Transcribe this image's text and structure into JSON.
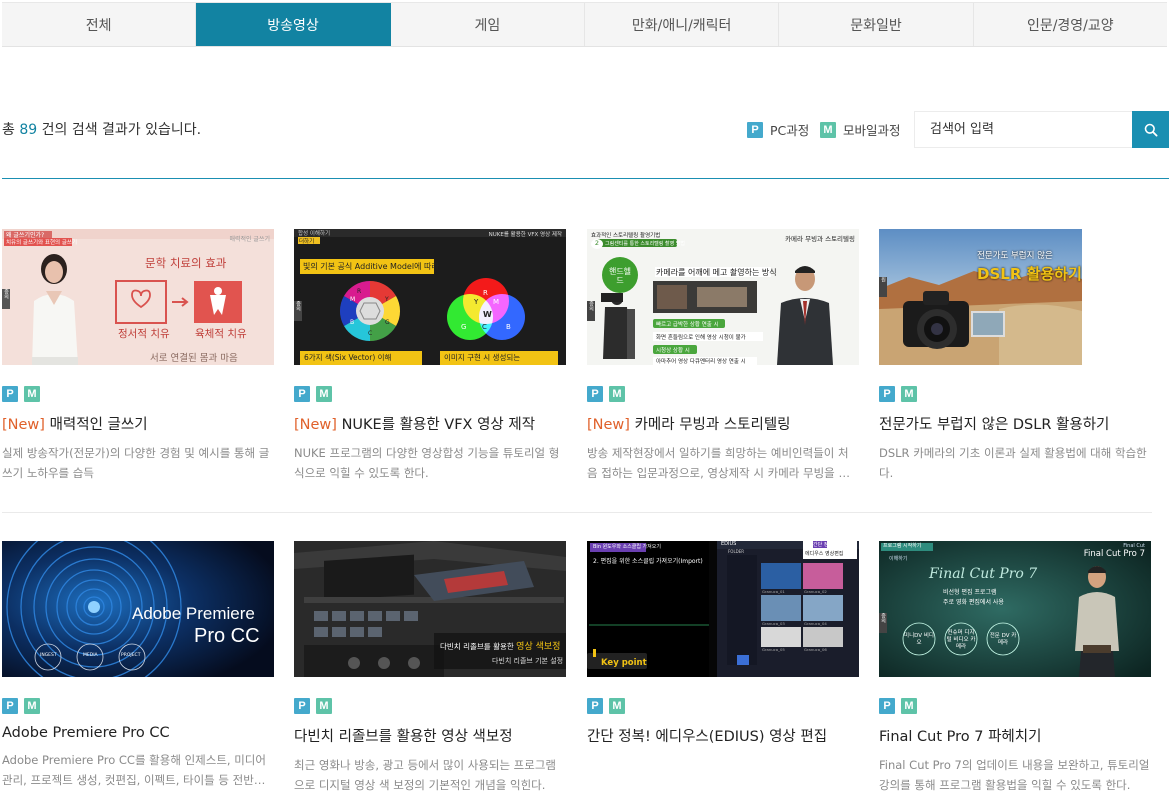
{
  "tabs": [
    {
      "label": "전체",
      "active": false
    },
    {
      "label": "방송영상",
      "active": true
    },
    {
      "label": "게임",
      "active": false
    },
    {
      "label": "만화/애니/캐릭터",
      "active": false
    },
    {
      "label": "문화일반",
      "active": false
    },
    {
      "label": "인문/경영/교양",
      "active": false
    }
  ],
  "results": {
    "prefix": "총",
    "count": "89",
    "suffix": "건의 검색 결과가 있습니다."
  },
  "legend": {
    "pc": {
      "badge": "P",
      "label": "PC과정"
    },
    "mobile": {
      "badge": "M",
      "label": "모바일과정"
    }
  },
  "search": {
    "placeholder": "검색어 입력",
    "button_icon": "search-icon"
  },
  "colors": {
    "accent": "#1283a2",
    "badge_pc": "#44a9cc",
    "badge_mobile": "#5ec3a8",
    "new_tag": "#e0612b"
  },
  "courses": [
    {
      "new_tag": "[New]",
      "title": "매력적인 글쓰기",
      "desc": "실제 방송작가(전문가)의 다양한 경험 및 예시를 통해 글쓰기 노하우를 습득",
      "badges": [
        "P",
        "M"
      ],
      "thumb": {
        "top_left": "왜 글쓰기인가?",
        "top_left_sub": "치유의 글쓰기와 표현의 글쓰기",
        "top_right": "매력적인 글쓰기",
        "heading": "문학 치료의 효과",
        "box_left": "정서적 치유",
        "box_right": "육체적 치유",
        "caption": "서로 연결된 몸과 마음",
        "side": "중의"
      }
    },
    {
      "new_tag": "[New]",
      "title": "NUKE를 활용한 VFX 영상 제작",
      "desc": "NUKE 프로그램의 다양한 영상합성 기능을 튜토리얼 형식으로 익힐 수 있도록 한다.",
      "badges": [
        "P",
        "M"
      ],
      "thumb": {
        "top_left": "합성 이해하기",
        "top_left_sub": "더하기",
        "brand": "NUKE를 활용한 VFX 영상 제작",
        "banner": "빛의 기본 공식 Additive Model에 따라",
        "caption_left": "6가지 색(Six Vector) 이해",
        "caption_right": "이미지 구현 시 생성되는",
        "side": "중의",
        "wheel": [
          "R",
          "Y",
          "G",
          "C",
          "B",
          "M"
        ],
        "rgb": [
          "R",
          "G",
          "B",
          "Y",
          "C",
          "M",
          "W"
        ]
      }
    },
    {
      "new_tag": "[New]",
      "title": "카메라 무빙과 스토리텔링",
      "desc": "방송 제작현장에서 일하기를 희망하는 예비인력들이 처음 접하는 입문과정으로, 영상제작 시 카메라 무빙을 통한 스토리텔링 기법을 익힌다.",
      "badges": [
        "P",
        "M"
      ],
      "thumb": {
        "top_left": "효과적인 스토리텔링 촬영기법",
        "step_num": "2",
        "step": "그림센티를 통한 스토리텔링 촬영 방법",
        "brand": "카메라 무빙과 스토리텔링",
        "circle": "핸드헬드",
        "headline": "카메라를 어깨에 메고 촬영하는 방식",
        "bullets": [
          "빠르고 급박한 상황 연출 시",
          "화면 흔들림으로 인해 영상 시청이 불가",
          "시청상 상황 시",
          "아마추어 영상 다큐멘터리 영상 연출 시"
        ],
        "side": "중의"
      }
    },
    {
      "new_tag": "",
      "title": "전문가도 부럽지 않은 DSLR 활용하기",
      "desc": "DSLR 카메라의 기초 이론과 실제 활용법에 대해 학습한다.",
      "badges": [
        "P",
        "M"
      ],
      "thumb": {
        "line1": "전문가도 부럽지 않은",
        "line2": "DSLR 활용하기",
        "side": "원"
      }
    },
    {
      "new_tag": "",
      "title": "Adobe Premiere Pro CC",
      "desc": "Adobe Premiere Pro CC를 활용해 인제스트, 미디어관리, 프로젝트 생성, 컷편집, 이펙트, 타이틀 등 전반적인 영상 편집 기능을 익힌다.",
      "badges": [
        "P",
        "M"
      ],
      "thumb": {
        "line1": "Adobe Premiere",
        "line2": "Pro CC",
        "chips": [
          "INGEST",
          "MEDIA",
          "PROJECT"
        ]
      }
    },
    {
      "new_tag": "",
      "title": "다빈치 리졸브를 활용한 영상 색보정",
      "desc": "최근 영화나 방송, 광고 등에서 많이 사용되는 프로그램으로 디지털 영상 색 보정의 기본적인 개념을 익힌다.",
      "badges": [
        "P",
        "M"
      ],
      "thumb": {
        "line1": "다빈치 리졸브를 활용한",
        "line1_hl": "영상 색보정",
        "line2": "다빈치 리졸브 기본 설정"
      }
    },
    {
      "new_tag": "",
      "title": "간단 정복! 에디우스(EDIUS) 영상 편집",
      "desc": "",
      "badges": [
        "P",
        "M"
      ],
      "thumb": {
        "top_left": "Bin 윈도우와 소스클립 가져오기",
        "step": "2. 편집을 위한 소스클립 가져오기(Import)",
        "brand": "에디우스 영상편집",
        "brand_tag": "간단 정복",
        "keypoint": "Key point",
        "app": "EDIUS",
        "folder": "FOLDER",
        "files": [
          "Granuca_01",
          "Granuca_02",
          "Granuca_03",
          "Granuca_04",
          "Granuca_05",
          "Granuca_06"
        ]
      }
    },
    {
      "new_tag": "",
      "title": "Final Cut Pro 7 파헤치기",
      "desc": "Final Cut Pro 7의 업데이트 내용을 보완하고, 튜토리얼 강의를 통해 프로그램 활용법을 익힐 수 있도록 한다.",
      "badges": [
        "P",
        "M"
      ],
      "thumb": {
        "top_left": "프로그램 시작하기",
        "top_left_sub": "이해하기",
        "brand": "Final Cut Pro 7",
        "brand_pre": "Final Cut",
        "headline": "Final Cut Pro 7",
        "bullets": [
          "비선형 편집 프로그램",
          "주로 영화 편집에서 사용"
        ],
        "circles": [
          "미니DV 비디오",
          "컨슈머 디지털 비디오 카메라",
          "전문 DV 카메라"
        ],
        "side": "중의"
      }
    }
  ]
}
